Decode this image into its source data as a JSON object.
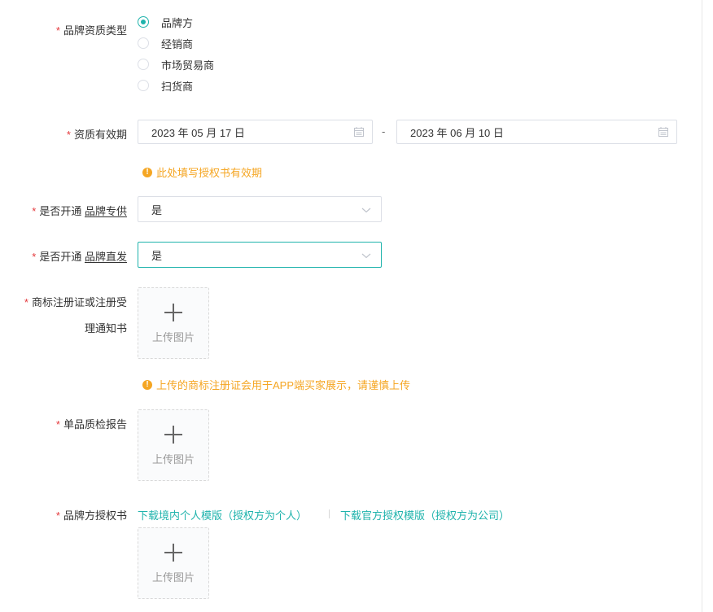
{
  "form": {
    "brand_type": {
      "label": "品牌资质类型",
      "options": [
        "品牌方",
        "经销商",
        "市场贸易商",
        "扫货商"
      ],
      "selected": "品牌方"
    },
    "validity": {
      "label": "资质有效期",
      "start": "2023 年 05 月 17 日",
      "end": "2023 年 06 月 10 日",
      "separator": "-",
      "hint": "此处填写授权书有效期"
    },
    "brand_exclusive": {
      "label_prefix": "是否开通",
      "label_link": "品牌专供",
      "value": "是"
    },
    "brand_direct": {
      "label_prefix": "是否开通",
      "label_link": "品牌直发",
      "value": "是"
    },
    "trademark": {
      "label_line1": "商标注册证或注册受",
      "label_line2": "理通知书",
      "upload_text": "上传图片",
      "hint": "上传的商标注册证会用于APP端买家展示，请谨慎上传"
    },
    "inspection": {
      "label": "单品质检报告",
      "upload_text": "上传图片"
    },
    "authorization": {
      "label": "品牌方授权书",
      "link_personal": "下载境内个人模版（授权方为个人）",
      "link_company": "下载官方授权模版（授权方为公司）",
      "upload_text": "上传图片"
    }
  },
  "required_mark": "*",
  "colors": {
    "accent": "#1fb3ac",
    "required": "#e4393c",
    "warning": "#f5a623",
    "border": "#dcdfe6"
  }
}
